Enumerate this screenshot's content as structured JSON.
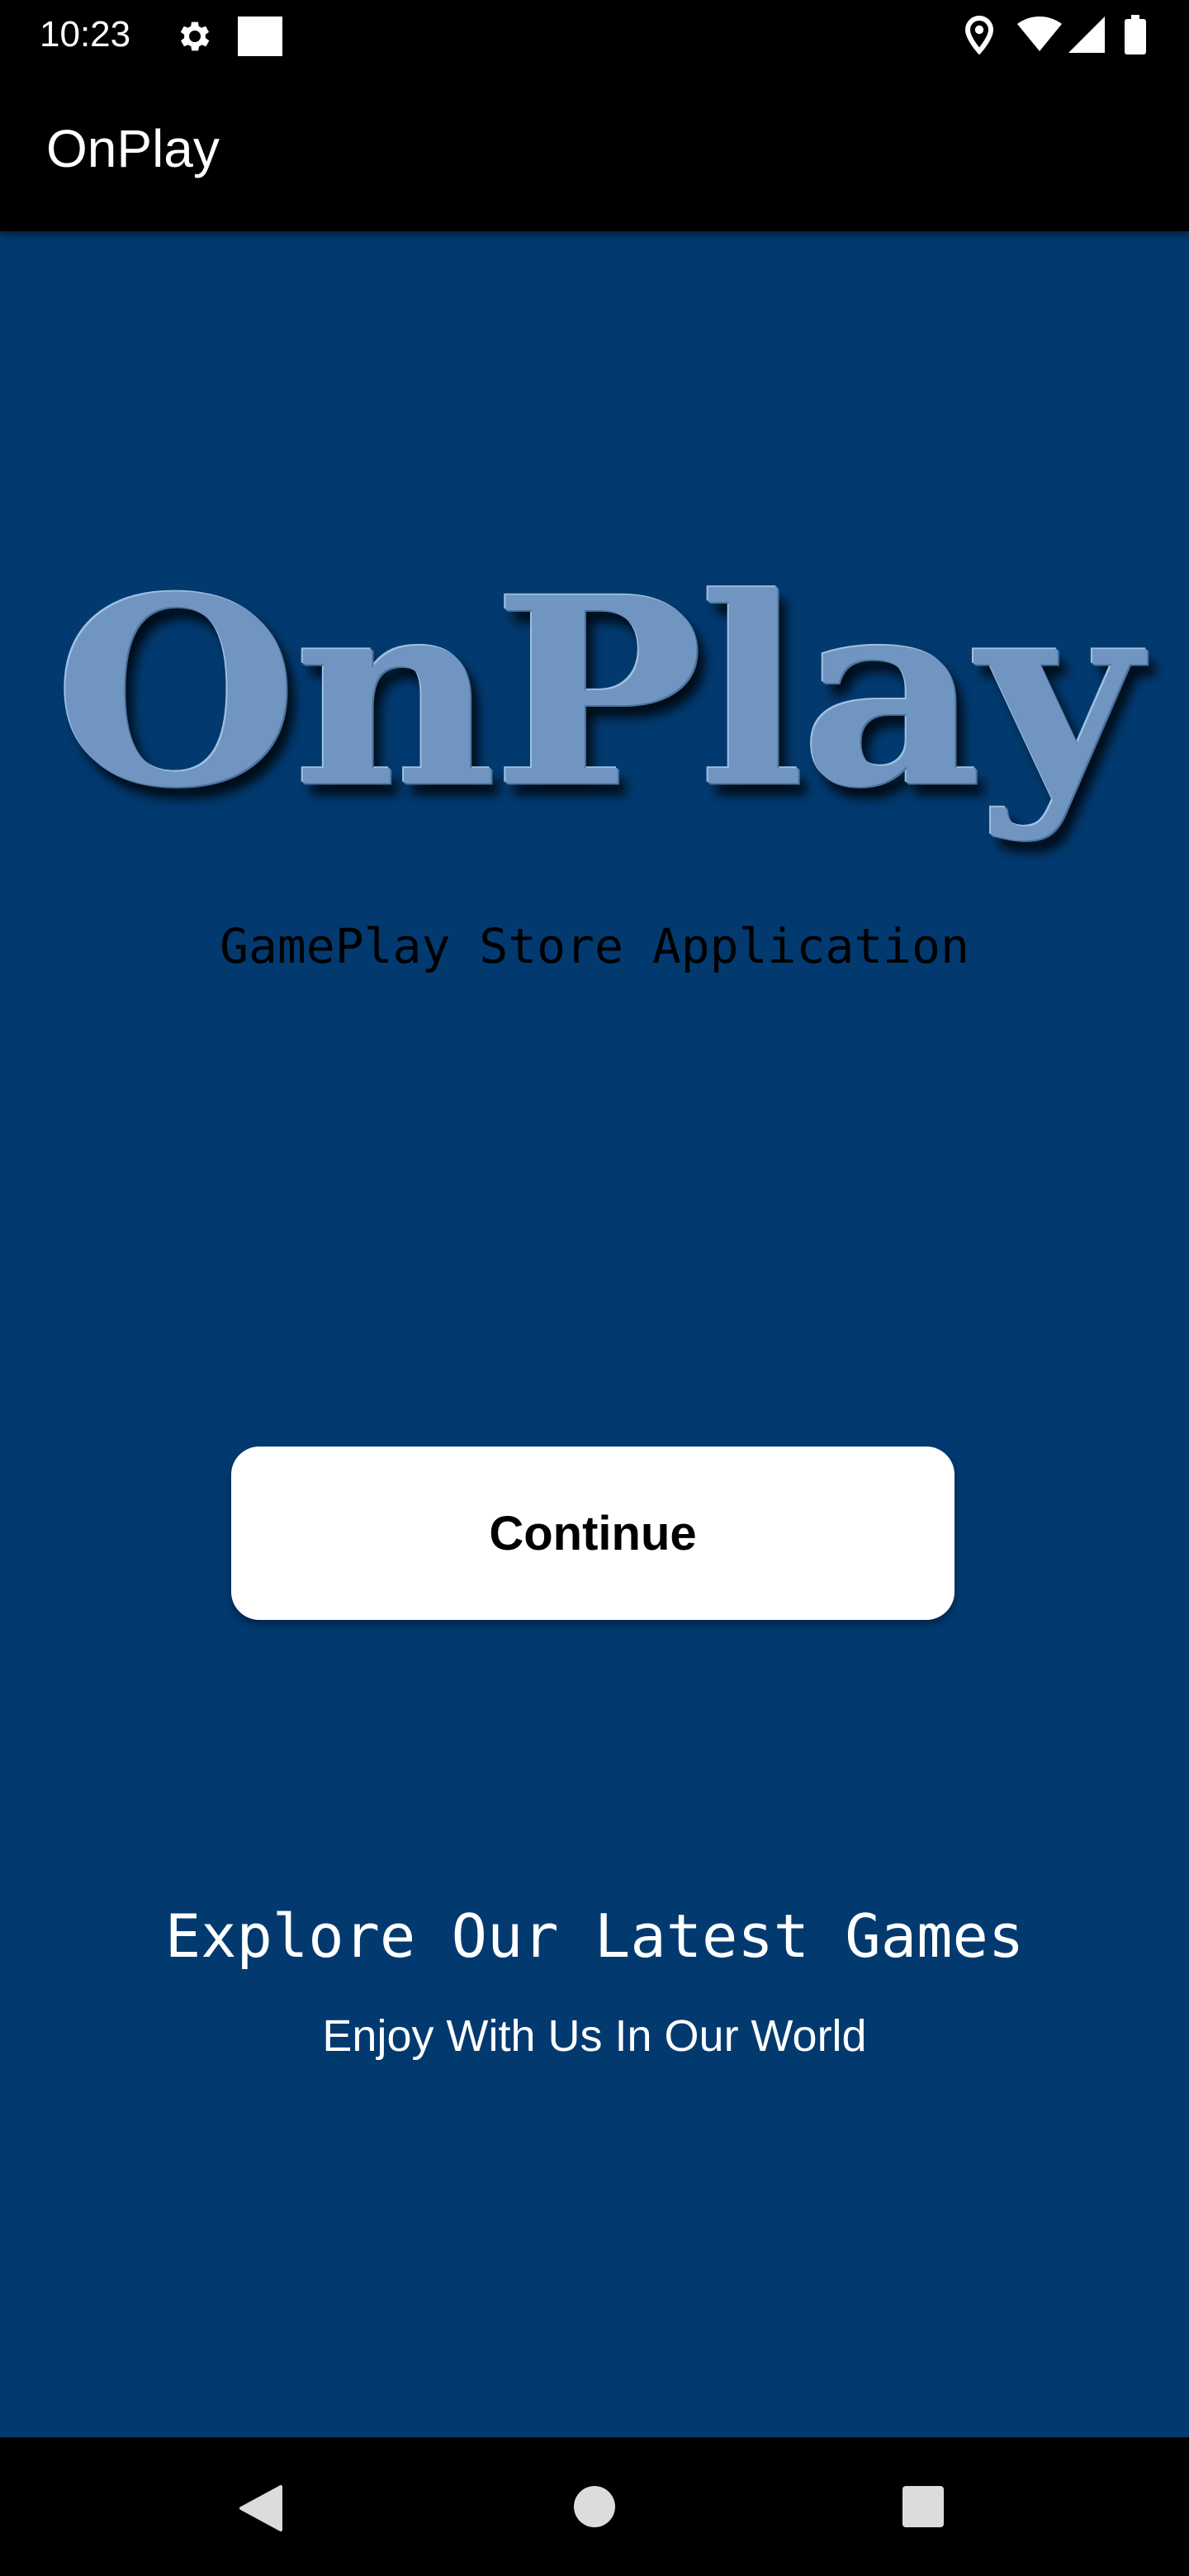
{
  "status_bar": {
    "time": "10:23",
    "icons": [
      "gear-icon",
      "notification-square-icon",
      "location-icon",
      "wifi-icon",
      "cellular-signal-icon",
      "battery-icon"
    ]
  },
  "app_bar": {
    "title": "OnPlay"
  },
  "main": {
    "logo_text": "OnPlay",
    "tagline": "GamePlay Store Application",
    "continue_label": "Continue",
    "explore_heading": "Explore Our Latest Games",
    "explore_subtitle": "Enjoy With Us In Our World"
  },
  "nav_bar": {
    "icons": [
      "back-icon",
      "home-icon",
      "recents-icon"
    ]
  },
  "colors": {
    "background": "#023a70",
    "bars": "#000000",
    "logo": "#6f95c0",
    "button": "#ffffff",
    "text_light": "#ffffff",
    "text_dark": "#000000"
  }
}
